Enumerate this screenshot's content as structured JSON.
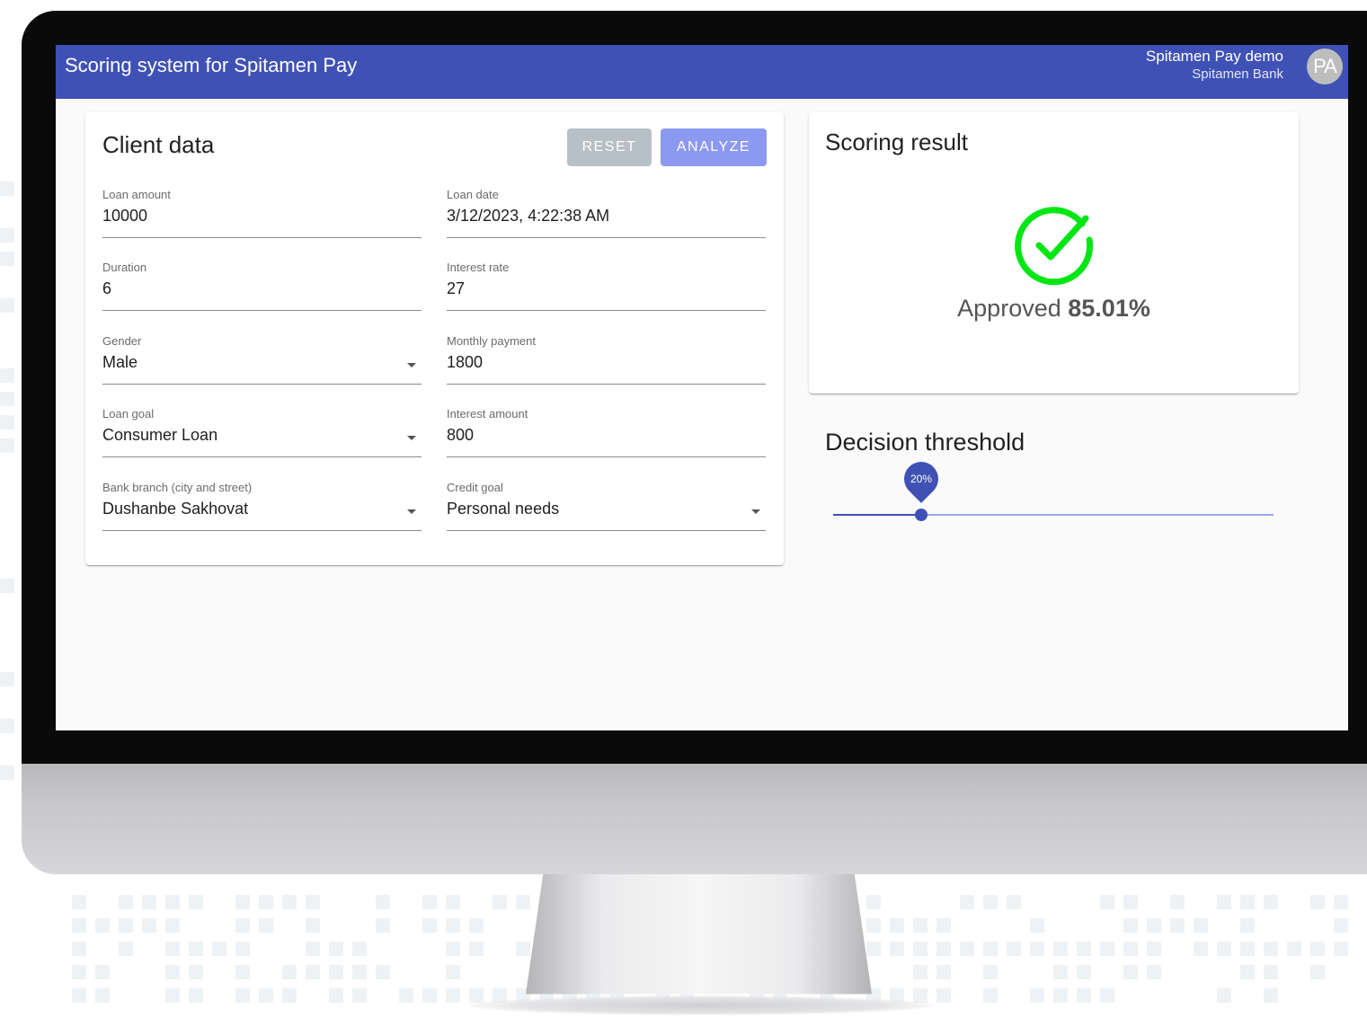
{
  "appbar": {
    "title": "Scoring system for Spitamen Pay",
    "user_name": "Spitamen Pay demo",
    "user_org": "Spitamen Bank",
    "avatar_initials": "PA"
  },
  "client_data": {
    "title": "Client data",
    "reset_label": "RESET",
    "analyze_label": "ANALYZE",
    "fields": {
      "loan_amount": {
        "label": "Loan amount",
        "value": "10000"
      },
      "loan_date": {
        "label": "Loan date",
        "value": "3/12/2023, 4:22:38 AM"
      },
      "duration": {
        "label": "Duration",
        "value": "6"
      },
      "interest_rate": {
        "label": "Interest rate",
        "value": "27"
      },
      "gender": {
        "label": "Gender",
        "value": "Male"
      },
      "monthly_payment": {
        "label": "Monthly payment",
        "value": "1800"
      },
      "loan_goal": {
        "label": "Loan goal",
        "value": "Consumer Loan"
      },
      "interest_amount": {
        "label": "Interest amount",
        "value": "800"
      },
      "bank_branch": {
        "label": "Bank branch (city and street)",
        "value": "Dushanbe Sakhovat"
      },
      "credit_goal": {
        "label": "Credit goal",
        "value": "Personal needs"
      }
    }
  },
  "scoring_result": {
    "title": "Scoring result",
    "status": "Approved",
    "percentage": "85.01%",
    "icon": "check-circle-icon",
    "icon_color": "#00e615"
  },
  "decision_threshold": {
    "title": "Decision threshold",
    "value_label": "20%",
    "value": 0.2
  },
  "colors": {
    "primary": "#3f51b5",
    "reset_button": "#b7c0c6",
    "analyze_button": "#8b99f0",
    "approved_green": "#00e615"
  }
}
